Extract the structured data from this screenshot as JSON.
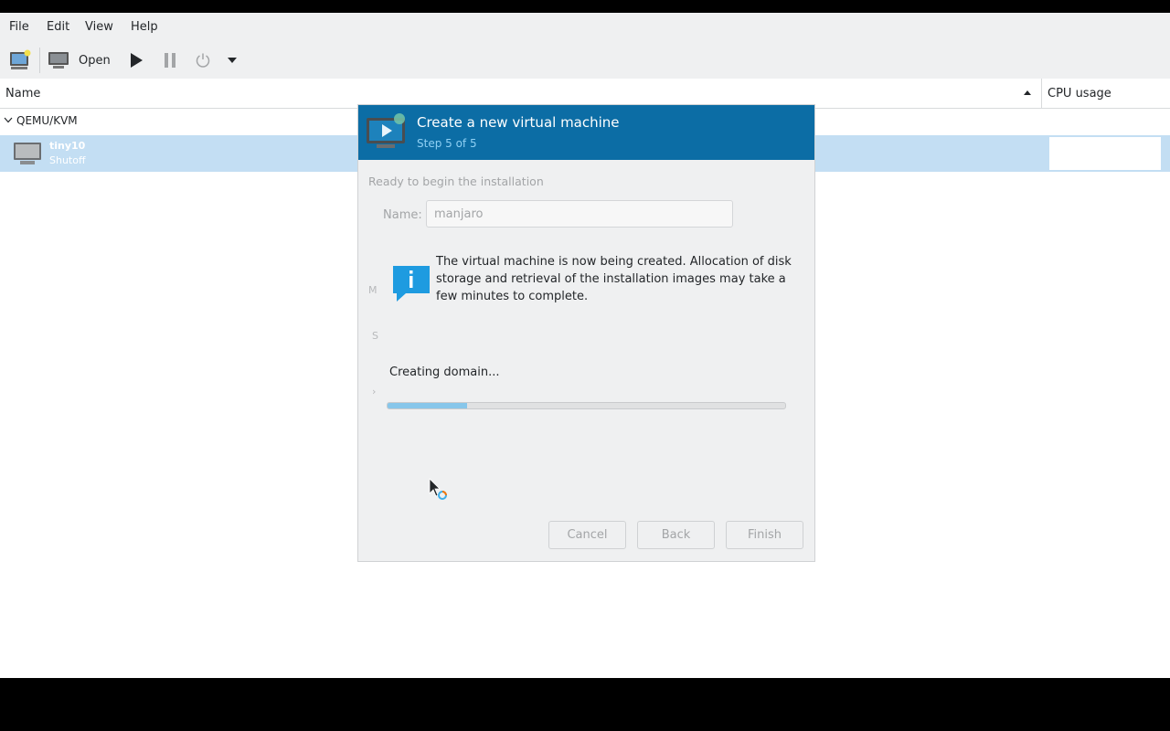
{
  "menubar": {
    "items": [
      "File",
      "Edit",
      "View",
      "Help"
    ]
  },
  "toolbar": {
    "new_vm_icon": "new-vm-monitor-icon",
    "open_icon": "monitor-icon",
    "open_label": "Open",
    "run_icon": "play-icon",
    "pause_icon": "pause-icon",
    "power_icon": "power-icon",
    "dropdown_icon": "caret-down-icon"
  },
  "columns": {
    "name": "Name",
    "cpu": "CPU usage"
  },
  "list": {
    "group_label": "QEMU/KVM",
    "vm": {
      "name": "tiny10",
      "status": "Shutoff"
    }
  },
  "dialog": {
    "title": "Create a new virtual machine",
    "step": "Step 5 of 5",
    "ready_text": "Ready to begin the installation",
    "name_label": "Name:",
    "name_value": "manjaro",
    "info_text": "The virtual machine is now being created. Allocation of disk storage and retrieval of the installation images may take a few minutes to complete.",
    "progress_label": "Creating domain...",
    "progress_fraction": 0.2,
    "buttons": {
      "cancel": "Cancel",
      "back": "Back",
      "finish": "Finish"
    }
  },
  "colors": {
    "header_bg": "#0c6da5",
    "selection": "#c3def3",
    "progress": "#87c6ea",
    "window_bg": "#eff0f1"
  }
}
